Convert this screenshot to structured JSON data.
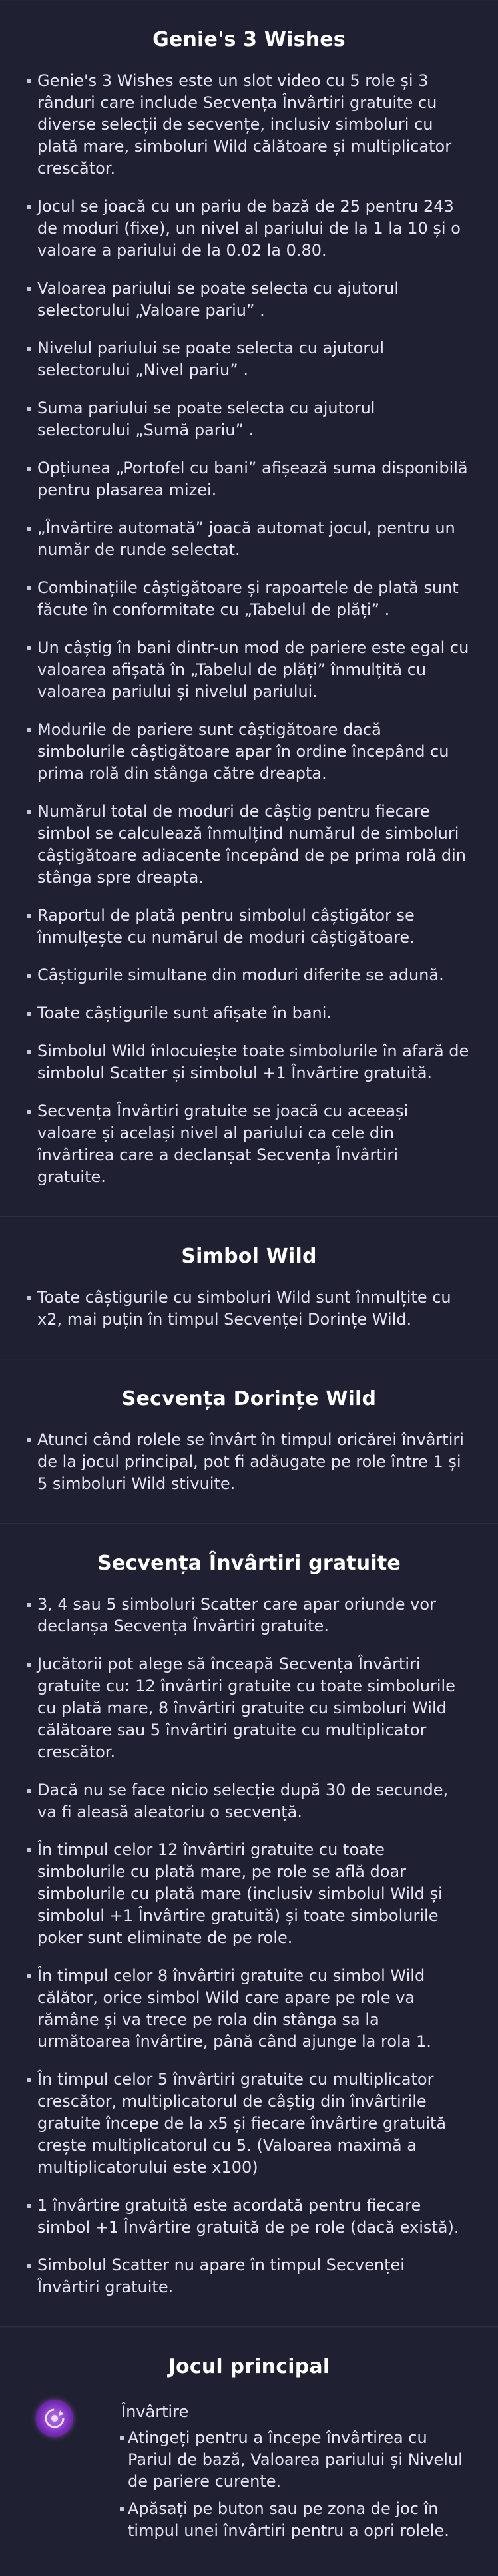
{
  "sections": [
    {
      "title": "Genie's 3 Wishes",
      "items": [
        "Genie's 3 Wishes este un slot video cu 5 role și 3 rânduri care include Secvența Învârtiri gratuite cu diverse selecții de secvențe, inclusiv simboluri cu plată mare, simboluri Wild călătoare și multiplicator crescător.",
        "Jocul se joacă cu un pariu de bază de 25 pentru 243 de moduri (fixe), un nivel al pariului de la 1 la 10 și o valoare a pariului de la 0.02 la 0.80.",
        "Valoarea pariului se poate selecta cu ajutorul selectorului „Valoare pariu”  .",
        "Nivelul pariului se poate selecta cu ajutorul selectorului „Nivel pariu”  .",
        "Suma pariului se poate selecta cu ajutorul selectorului „Sumă pariu”  .",
        "Opțiunea „Portofel cu bani”   afișează suma disponibilă pentru plasarea mizei.",
        "„Învârtire automată”   joacă automat jocul, pentru un număr de runde selectat.",
        "Combinațiile câștigătoare și rapoartele de plată sunt făcute în conformitate cu „Tabelul de plăți”  .",
        "Un câștig în bani dintr-un mod de pariere este egal cu valoarea afișată în „Tabelul de plăți”   înmulțită cu valoarea pariului și nivelul pariului.",
        "Modurile de pariere sunt câștigătoare dacă simbolurile câștigătoare apar în ordine începând cu prima rolă din stânga către dreapta.",
        "Numărul total de moduri de câștig pentru fiecare simbol se calculează înmulțind numărul de simboluri câștigătoare adiacente începând de pe prima rolă din stânga spre dreapta.",
        "Raportul de plată pentru simbolul câștigător se înmulțește cu numărul de moduri câștigătoare.",
        "Câștigurile simultane din moduri diferite se adună.",
        "Toate câștigurile sunt afișate în bani.",
        "Simbolul Wild înlocuiește toate simbolurile în afară de simbolul Scatter și simbolul +1 Învârtire gratuită.",
        "Secvența Învârtiri gratuite se joacă cu aceeași valoare și același nivel al pariului ca cele din învârtirea care a declanșat Secvența Învârtiri gratuite."
      ]
    },
    {
      "title": "Simbol Wild",
      "items": [
        "Toate câștigurile cu simboluri Wild sunt înmulțite cu x2, mai puțin în timpul Secvenței Dorințe Wild."
      ]
    },
    {
      "title": "Secvența Dorințe Wild",
      "items": [
        "Atunci când rolele se învârt în timpul oricărei învârtiri de la jocul principal, pot fi adăugate pe role între 1 și 5 simboluri Wild stivuite."
      ]
    },
    {
      "title": "Secvența Învârtiri gratuite",
      "items": [
        "3, 4 sau 5 simboluri Scatter care apar oriunde vor declanșa Secvența Învârtiri gratuite.",
        "Jucătorii pot alege să înceapă Secvența Învârtiri gratuite cu: 12 învârtiri gratuite cu toate simbolurile cu plată mare, 8 învârtiri gratuite cu simboluri Wild călătoare sau 5 învârtiri gratuite cu multiplicator crescător.",
        "Dacă nu se face nicio selecție după 30 de secunde, va fi aleasă aleatoriu o secvență.",
        "În timpul celor 12 învârtiri gratuite cu toate simbolurile cu plată mare, pe role se află doar simbolurile cu plată mare (inclusiv simbolul Wild și simbolul +1 Învârtire gratuită) și toate simbolurile poker sunt eliminate de pe role.",
        "În timpul celor 8 învârtiri gratuite cu simbol Wild călător, orice simbol Wild care apare pe role va rămâne și va trece pe rola din stânga sa la următoarea învârtire, până când ajunge la rola 1.",
        "În timpul celor 5 învârtiri gratuite cu multiplicator crescător, multiplicatorul de câștig din învârtirile gratuite începe de la x5 și fiecare învârtire gratuită crește multiplicatorul cu 5. (Valoarea maximă a multiplicatorului este x100)",
        "1 învârtire gratuită este acordată pentru fiecare simbol +1 Învârtire gratuită de pe role (dacă există).",
        "Simbolul Scatter nu apare în timpul Secvenței Învârtiri gratuite."
      ]
    }
  ],
  "main_game": {
    "title": "Jocul principal",
    "icon": "spin-icon",
    "heading": "Învârtire",
    "items": [
      "Atingeți pentru a începe învârtirea cu Pariul de bază, Valoarea pariului și Nivelul de pariere curente.",
      "Apăsați pe buton sau pe zona de joc în timpul unei învârtiri pentru a opri rolele."
    ]
  },
  "colors": {
    "background": "#1f2132",
    "text": "#e4e5f0",
    "title": "#ffffff",
    "icon_accent": "#8a3fd1"
  }
}
